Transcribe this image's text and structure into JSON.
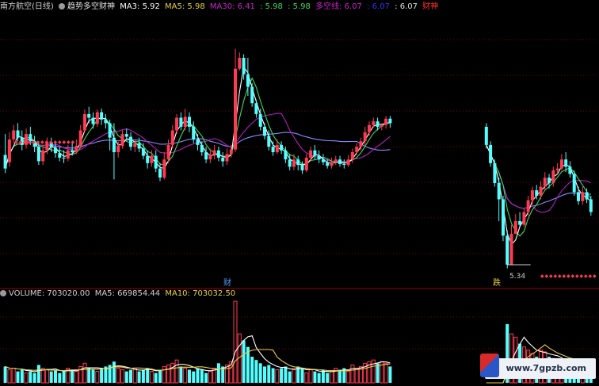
{
  "header": {
    "stock": "南方航空(日线)",
    "indicator": "趋势多空财神",
    "ma3": "MA3: 5.92",
    "ma5": "MA5: 5.98",
    "ma30": "MA30: 6.41",
    "v1": ": 5.98",
    "v2": ": 5.98",
    "duokong": "多空线: 6.07",
    "v3": ": 6.07",
    "v4": ": 6.07",
    "caishen": "财神"
  },
  "volume_header": {
    "volume": "VOLUME: 703020.00",
    "ma5": "MA5: 669854.44",
    "ma10": "MA10: 703032.50"
  },
  "annotations": {
    "cai": "财",
    "die": "跌",
    "low": "5.34"
  },
  "watermark": "www.7gpzb.com",
  "colors": {
    "up": "#ff3a52",
    "down": "#54ffff",
    "ma_white": "#ffffff",
    "ma_yellow": "#e8d040",
    "ma_green": "#3cd85a",
    "ma_purple": "#b020c0",
    "ma_blue": "#8a8aff",
    "grid": "#7a0000"
  },
  "chart_data": [
    {
      "type": "candlestick",
      "series_names": [
        "MA3",
        "MA5",
        "MA30",
        "多空线"
      ],
      "ylim": [
        5.2,
        8.1
      ],
      "candles": [
        [
          6.55,
          6.4,
          6.78,
          6.35
        ],
        [
          6.47,
          6.72,
          6.8,
          6.42
        ],
        [
          6.72,
          6.82,
          6.88,
          6.68
        ],
        [
          6.82,
          6.74,
          6.9,
          6.7
        ],
        [
          6.74,
          6.66,
          6.82,
          6.6
        ],
        [
          6.66,
          6.78,
          6.84,
          6.62
        ],
        [
          6.78,
          6.7,
          6.86,
          6.66
        ],
        [
          6.7,
          6.64,
          6.76,
          6.58
        ],
        [
          6.64,
          6.48,
          6.7,
          6.44
        ],
        [
          6.48,
          6.6,
          6.66,
          6.44
        ],
        [
          6.6,
          6.69,
          6.74,
          6.56
        ],
        [
          6.69,
          6.63,
          6.74,
          6.58
        ],
        [
          6.63,
          6.57,
          6.68,
          6.52
        ],
        [
          6.57,
          6.52,
          6.64,
          6.48
        ],
        [
          6.52,
          6.51,
          6.6,
          6.46
        ],
        [
          6.51,
          6.6,
          6.66,
          6.48
        ],
        [
          6.6,
          6.58,
          6.68,
          6.54
        ],
        [
          6.58,
          6.65,
          6.72,
          6.56
        ],
        [
          6.65,
          6.82,
          6.88,
          6.62
        ],
        [
          6.82,
          7.0,
          7.05,
          6.8
        ],
        [
          7.0,
          6.96,
          7.08,
          6.9
        ],
        [
          6.96,
          6.89,
          7.02,
          6.84
        ],
        [
          6.89,
          7.02,
          7.05,
          6.86
        ],
        [
          7.02,
          6.94,
          7.06,
          6.88
        ],
        [
          6.94,
          6.9,
          7.0,
          6.84
        ],
        [
          6.9,
          6.74,
          6.94,
          6.6
        ],
        [
          6.74,
          6.58,
          6.9,
          6.28
        ],
        [
          6.58,
          6.65,
          6.7,
          6.52
        ],
        [
          6.65,
          6.78,
          6.82,
          6.62
        ],
        [
          6.78,
          6.75,
          6.84,
          6.72
        ],
        [
          6.75,
          6.64,
          6.8,
          6.6
        ],
        [
          6.64,
          6.68,
          6.72,
          6.58
        ],
        [
          6.68,
          6.62,
          6.74,
          6.58
        ],
        [
          6.62,
          6.54,
          6.68,
          6.5
        ],
        [
          6.54,
          6.46,
          6.6,
          6.4
        ],
        [
          6.46,
          6.54,
          6.6,
          6.42
        ],
        [
          6.54,
          6.4,
          6.6,
          6.36
        ],
        [
          6.4,
          6.3,
          6.46,
          6.26
        ],
        [
          6.3,
          6.5,
          6.58,
          6.28
        ],
        [
          6.5,
          6.66,
          6.72,
          6.46
        ],
        [
          6.66,
          6.82,
          6.88,
          6.62
        ],
        [
          6.82,
          6.96,
          7.0,
          6.78
        ],
        [
          6.96,
          6.86,
          7.02,
          6.82
        ],
        [
          6.86,
          6.97,
          7.06,
          6.82
        ],
        [
          6.97,
          6.86,
          7.02,
          6.8
        ],
        [
          6.86,
          6.72,
          6.92,
          6.68
        ],
        [
          6.72,
          6.66,
          6.78,
          6.6
        ],
        [
          6.66,
          6.58,
          6.7,
          6.54
        ],
        [
          6.58,
          6.5,
          6.64,
          6.46
        ],
        [
          6.5,
          6.55,
          6.62,
          6.46
        ],
        [
          6.55,
          6.6,
          6.66,
          6.5
        ],
        [
          6.6,
          6.52,
          6.64,
          6.48
        ],
        [
          6.52,
          6.48,
          6.58,
          6.42
        ],
        [
          6.48,
          6.56,
          6.62,
          6.44
        ],
        [
          6.56,
          6.61,
          6.66,
          6.52
        ],
        [
          6.61,
          7.5,
          7.72,
          6.58
        ],
        [
          7.5,
          7.62,
          7.68,
          7.48
        ],
        [
          7.62,
          7.44,
          7.66,
          7.38
        ],
        [
          7.44,
          7.3,
          7.62,
          7.2
        ],
        [
          7.3,
          7.12,
          7.34,
          7.08
        ],
        [
          7.12,
          7.0,
          7.16,
          6.96
        ],
        [
          7.0,
          6.86,
          7.06,
          6.82
        ],
        [
          6.86,
          6.76,
          6.9,
          6.72
        ],
        [
          6.76,
          6.64,
          6.82,
          6.6
        ],
        [
          6.64,
          6.58,
          6.7,
          6.54
        ],
        [
          6.58,
          6.66,
          6.72,
          6.56
        ],
        [
          6.66,
          6.6,
          6.7,
          6.56
        ],
        [
          6.6,
          6.5,
          6.64,
          6.46
        ],
        [
          6.5,
          6.42,
          6.56,
          6.38
        ],
        [
          6.42,
          6.5,
          6.56,
          6.38
        ],
        [
          6.5,
          6.44,
          6.54,
          6.38
        ],
        [
          6.44,
          6.38,
          6.48,
          6.34
        ],
        [
          6.38,
          6.52,
          6.56,
          6.36
        ],
        [
          6.52,
          6.6,
          6.64,
          6.48
        ],
        [
          6.6,
          6.54,
          6.66,
          6.5
        ],
        [
          6.54,
          6.5,
          6.6,
          6.46
        ],
        [
          6.5,
          6.47,
          6.56,
          6.44
        ],
        [
          6.47,
          6.43,
          6.5,
          6.4
        ],
        [
          6.43,
          6.47,
          6.52,
          6.4
        ],
        [
          6.47,
          6.5,
          6.54,
          6.44
        ],
        [
          6.5,
          6.45,
          6.54,
          6.42
        ],
        [
          6.45,
          6.44,
          6.5,
          6.4
        ],
        [
          6.44,
          6.5,
          6.55,
          6.42
        ],
        [
          6.5,
          6.58,
          6.62,
          6.46
        ],
        [
          6.58,
          6.64,
          6.68,
          6.55
        ],
        [
          6.64,
          6.7,
          6.74,
          6.6
        ],
        [
          6.7,
          6.8,
          6.86,
          6.66
        ],
        [
          6.8,
          6.88,
          6.92,
          6.76
        ],
        [
          6.88,
          6.92,
          6.96,
          6.85
        ],
        [
          6.92,
          6.86,
          6.96,
          6.82
        ],
        [
          6.86,
          6.88,
          6.9,
          6.82
        ],
        [
          6.88,
          6.95,
          6.98,
          6.84
        ],
        [
          6.95,
          6.9,
          6.98,
          6.85
        ],
        null,
        null,
        null,
        null,
        null,
        null,
        null,
        null,
        null,
        null,
        null,
        null,
        null,
        null,
        null,
        null,
        null,
        null,
        null,
        null,
        null,
        null,
        [
          6.86,
          6.66,
          6.9,
          6.62
        ],
        [
          6.66,
          6.46,
          6.7,
          6.42
        ],
        [
          6.46,
          6.24,
          6.5,
          6.2
        ],
        [
          6.24,
          6.06,
          6.3,
          5.82
        ],
        [
          6.06,
          5.66,
          6.1,
          5.6
        ],
        [
          5.66,
          5.34,
          5.72,
          5.3
        ],
        [
          5.34,
          5.68,
          5.78,
          5.62
        ],
        [
          5.68,
          5.82,
          5.9,
          5.74
        ],
        [
          5.82,
          5.78,
          5.92,
          5.76
        ],
        [
          5.78,
          5.92,
          5.96,
          5.76
        ],
        [
          5.92,
          6.05,
          6.1,
          5.88
        ],
        [
          6.05,
          6.16,
          6.2,
          6.0
        ],
        [
          6.16,
          6.1,
          6.22,
          6.06
        ],
        [
          6.1,
          6.2,
          6.26,
          6.06
        ],
        [
          6.2,
          6.3,
          6.36,
          6.16
        ],
        [
          6.3,
          6.24,
          6.34,
          6.18
        ],
        [
          6.24,
          6.38,
          6.42,
          6.2
        ],
        [
          6.38,
          6.4,
          6.46,
          6.34
        ],
        [
          6.4,
          6.5,
          6.56,
          6.38
        ],
        [
          6.5,
          6.42,
          6.58,
          6.36
        ],
        [
          6.42,
          6.34,
          6.48,
          6.3
        ],
        [
          6.34,
          6.14,
          6.38,
          6.1
        ],
        [
          6.14,
          6.04,
          6.2,
          6.0
        ],
        [
          6.04,
          6.14,
          6.2,
          6.0
        ],
        [
          6.14,
          6.06,
          6.18,
          6.02
        ],
        [
          6.06,
          5.92,
          6.1,
          5.88
        ]
      ],
      "volumes": [
        1.0,
        0.8,
        0.9,
        0.7,
        0.8,
        0.6,
        0.7,
        0.6,
        1.1,
        0.9,
        0.8,
        0.7,
        0.8,
        0.6,
        0.7,
        0.9,
        0.8,
        0.7,
        1.0,
        1.2,
        0.9,
        0.8,
        0.7,
        0.9,
        1.0,
        1.1,
        1.3,
        0.9,
        0.8,
        0.7,
        0.8,
        0.9,
        0.7,
        0.8,
        0.9,
        0.7,
        0.6,
        0.8,
        1.0,
        1.1,
        1.2,
        1.4,
        1.0,
        0.9,
        0.8,
        0.7,
        0.9,
        0.8,
        0.6,
        0.7,
        0.9,
        1.2,
        1.0,
        1.1,
        1.3,
        5.0,
        3.0,
        2.6,
        2.2,
        1.6,
        1.4,
        1.2,
        1.0,
        1.1,
        0.9,
        0.8,
        0.9,
        1.0,
        0.7,
        0.8,
        1.0,
        0.9,
        0.6,
        0.8,
        0.7,
        0.6,
        0.8,
        0.6,
        0.7,
        0.9,
        0.8,
        0.9,
        0.7,
        1.1,
        0.9,
        1.0,
        1.2,
        1.3,
        1.4,
        1.2,
        1.3,
        1.2,
        1.0,
        0.9,
        0,
        0,
        0,
        0,
        0,
        0,
        0,
        0,
        0,
        0,
        0,
        0,
        0,
        0,
        0,
        0,
        0,
        0,
        0,
        0,
        0,
        0,
        0,
        0,
        0,
        0,
        3.6,
        3.0,
        2.8,
        2.4,
        2.2,
        2.0,
        1.8,
        1.6,
        2.0,
        1.9,
        1.6,
        1.5,
        1.3,
        1.4,
        1.1,
        1.0,
        1.2,
        1.0,
        0.9,
        0.8,
        1.0,
        1.2,
        1.4,
        1.1,
        0.9,
        0.8
      ],
      "markers": [
        {
          "index": 55,
          "text_key": "cai"
        },
        {
          "index": 125,
          "text_key": "die",
          "low": 5.34
        }
      ]
    }
  ]
}
